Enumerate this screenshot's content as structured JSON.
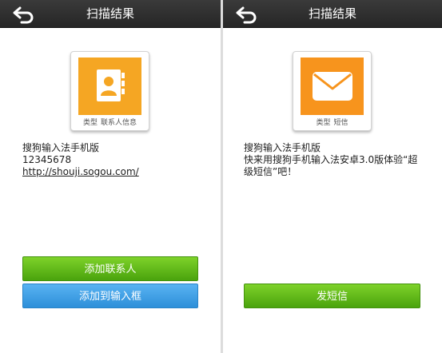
{
  "left_screen": {
    "title": "扫描结果",
    "type_card": {
      "icon": "contact-book-icon",
      "type_label": "类型",
      "type_value": "联系人信息"
    },
    "content": {
      "name": "搜狗输入法手机版",
      "phone": "12345678",
      "url": "http://shouji.sogou.com/"
    },
    "buttons": {
      "add_contact": "添加联系人",
      "add_to_input": "添加到输入框"
    }
  },
  "right_screen": {
    "title": "扫描结果",
    "type_card": {
      "icon": "envelope-icon",
      "type_label": "类型",
      "type_value": "短信"
    },
    "content": {
      "line1": "搜狗输入法手机版",
      "line2": "快来用搜狗手机输入法安卓3.0版体验“超",
      "line3": "级短信”吧！"
    },
    "buttons": {
      "send_sms": "发短信"
    }
  },
  "colors": {
    "titlebar": "#2e2e2e",
    "contact_icon_bg": "#f5a623",
    "sms_icon_bg": "#f7941d",
    "green_button": "#5cb718",
    "blue_button": "#3d9ee6"
  }
}
